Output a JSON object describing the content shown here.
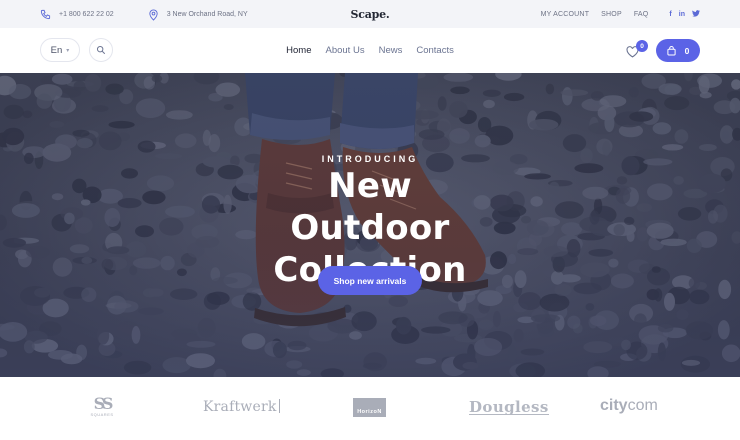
{
  "topbar": {
    "phone": "+1 800 622 22 02",
    "address": "3 New Orchand Road, NY",
    "brand": "Scape.",
    "links": [
      "MY ACCOUNT",
      "SHOP",
      "FAQ"
    ],
    "social": [
      "f",
      "in",
      "tw"
    ],
    "social_icons": [
      "facebook-icon",
      "linkedin-icon",
      "twitter-icon"
    ]
  },
  "nav": {
    "language": "En",
    "menu": [
      "Home",
      "About Us",
      "News",
      "Contacts"
    ],
    "active_item": "Home",
    "wishlist_count": "0",
    "cart_count": "0"
  },
  "hero": {
    "eyebrow": "INTRODUCING",
    "headline": "New Outdoor Collection",
    "cta_label": "Shop new arrivals"
  },
  "brands": {
    "logos": [
      {
        "name": "Squares",
        "mark": "SS",
        "caption": "SQUARES"
      },
      {
        "name": "Kraftwerk",
        "text": "Kraftwerk"
      },
      {
        "name": "HorizoN",
        "text": "HorizoN"
      },
      {
        "name": "Dougless",
        "text": "Dougless"
      },
      {
        "name": "citycom",
        "part1": "city",
        "part2": "com"
      }
    ]
  },
  "colors": {
    "accent": "#5b63e6",
    "topbar_bg": "#f3f4f8",
    "logo_gray": "#a9adb8"
  }
}
